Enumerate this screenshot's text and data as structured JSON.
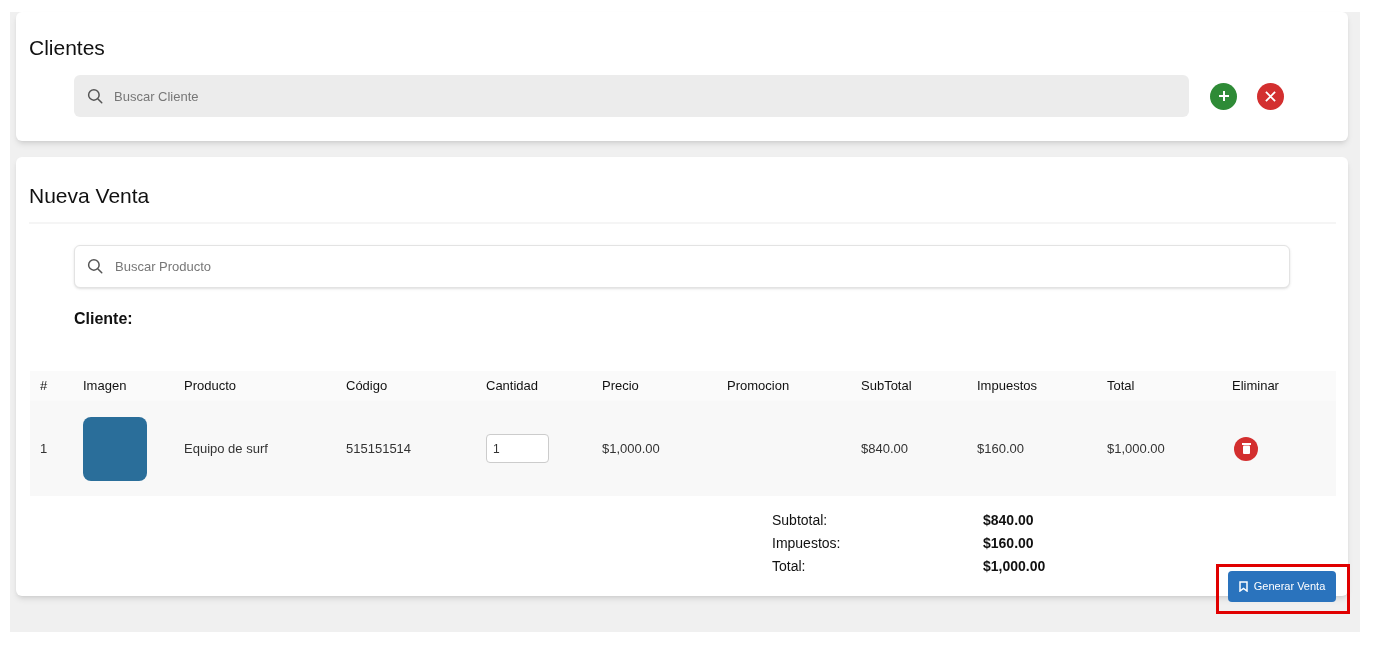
{
  "clientes": {
    "title": "Clientes",
    "search": {
      "placeholder": "Buscar Cliente"
    }
  },
  "nueva_venta": {
    "title": "Nueva Venta",
    "search": {
      "placeholder": "Buscar Producto"
    },
    "cliente_label": "Cliente:",
    "table": {
      "columns": [
        "#",
        "Imagen",
        "Producto",
        "Código",
        "Cantidad",
        "Precio",
        "Promocion",
        "SubTotal",
        "Impuestos",
        "Total",
        "Eliminar"
      ],
      "rows": [
        {
          "index": "1",
          "producto": "Equipo de surf",
          "codigo": "515151514",
          "cantidad": "1",
          "precio": "$1,000.00",
          "subtotal": "$840.00",
          "impuestos": "$160.00",
          "total": "$1,000.00"
        }
      ]
    },
    "totals": [
      {
        "label": "Subtotal:",
        "value": "$840.00"
      },
      {
        "label": "Impuestos:",
        "value": "$160.00"
      },
      {
        "label": "Total:",
        "value": "$1,000.00"
      }
    ],
    "generate_button": {
      "label": "Generar Venta",
      "highlighted": true
    }
  }
}
